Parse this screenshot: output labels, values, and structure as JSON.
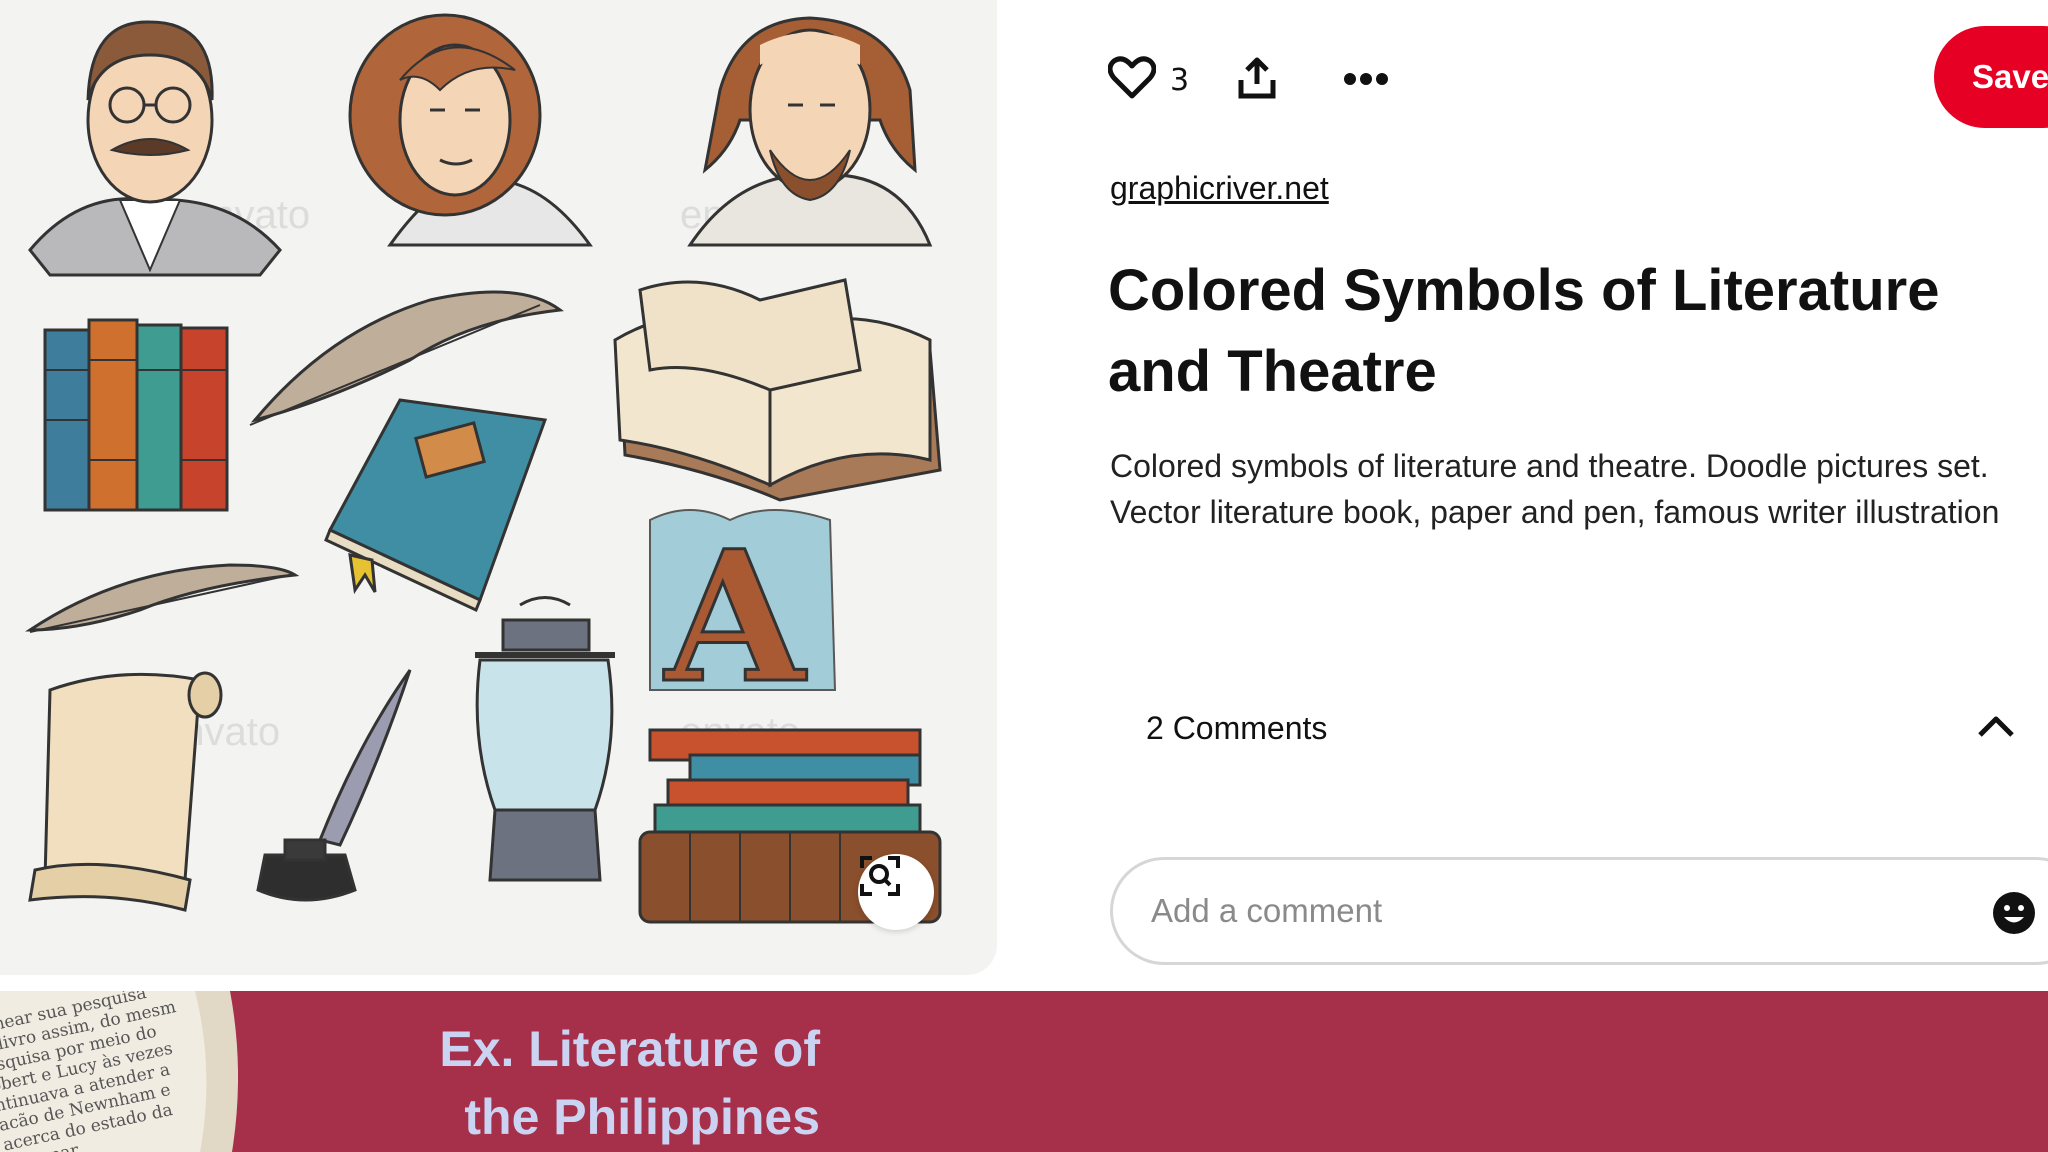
{
  "actions": {
    "like_count": "3",
    "save_label": "Save"
  },
  "pin": {
    "source": "graphicriver.net",
    "title": "Colored Symbols of Literature and Theatre",
    "description": "Colored symbols of literature and theatre. Doodle pictures set. Vector literature book, paper and pen, famous writer illustration"
  },
  "image": {
    "watermarks": [
      "envato",
      "envato",
      "envato",
      "envato"
    ]
  },
  "comments": {
    "count_label": "2 Comments",
    "input_placeholder": "Add a comment"
  },
  "banner": {
    "title": "Ex. Literature of the Philippines",
    "photo_text": [
      "olhear sua pesquisa",
      "o livro assim, do mesm",
      "esquisa por meio do",
      "obert e Lucy às vezes",
      "ntinuava a atender a",
      "acão de Newnham e",
      "acerca do estado da",
      "rdas par"
    ]
  },
  "colors": {
    "save": "#e60023",
    "banner": "#a6304a",
    "banner_text": "#cbd3f3",
    "panel": "#f3f3f2"
  },
  "icons": [
    "heart-icon",
    "share-icon",
    "more-icon",
    "visual-search-icon",
    "chevron-up-icon",
    "emoji-icon"
  ]
}
